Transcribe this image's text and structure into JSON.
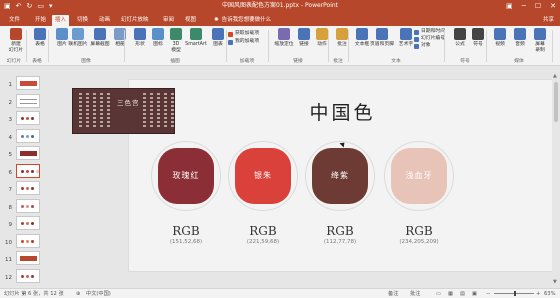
{
  "app": {
    "doc_title": "中国风图表配色方案01.pptx - PowerPoint"
  },
  "tabs": [
    "文件",
    "开始",
    "插入",
    "切换",
    "动画",
    "幻灯片放映",
    "审阅",
    "视图"
  ],
  "active_tab": "插入",
  "tell_me": "告诉我您想要做什么",
  "share_label": "共享",
  "ribbon": {
    "buttons": [
      {
        "label": "新建\n幻灯片",
        "icon": "new-slide-icon",
        "color": "#b7472a"
      },
      {
        "label": "表格",
        "icon": "table-icon",
        "color": "#4a73b8"
      },
      {
        "label": "图片",
        "icon": "picture-icon",
        "color": "#5a8fc9"
      },
      {
        "label": "联机图片",
        "icon": "online-picture-icon",
        "color": "#6b9bd1"
      },
      {
        "label": "屏幕截图",
        "icon": "screenshot-icon",
        "color": "#4a73b8"
      },
      {
        "label": "相册",
        "icon": "album-icon",
        "color": "#7a9bc7"
      },
      {
        "label": "形状",
        "icon": "shapes-icon",
        "color": "#4a73b8"
      },
      {
        "label": "图标",
        "icon": "icons-icon",
        "color": "#5a8fc9"
      },
      {
        "label": "3D\n模型",
        "icon": "3d-model-icon",
        "color": "#3d8a6b"
      },
      {
        "label": "SmartArt",
        "icon": "smartart-icon",
        "color": "#3d8a6b"
      },
      {
        "label": "图表",
        "icon": "chart-icon",
        "color": "#4a73b8"
      },
      {
        "label": "缩放定位",
        "icon": "zoom-icon",
        "color": "#7a6bb0"
      },
      {
        "label": "链接",
        "icon": "link-icon",
        "color": "#4a73b8"
      },
      {
        "label": "动作",
        "icon": "action-icon",
        "color": "#d6a13a"
      },
      {
        "label": "批注",
        "icon": "comment-icon",
        "color": "#d6a13a"
      },
      {
        "label": "文本框",
        "icon": "textbox-icon",
        "color": "#4a73b8"
      },
      {
        "label": "页眉和页脚",
        "icon": "header-footer-icon",
        "color": "#4a73b8"
      },
      {
        "label": "艺术字",
        "icon": "wordart-icon",
        "color": "#4a73b8"
      },
      {
        "label": "公式",
        "icon": "equation-icon",
        "color": "#444444"
      },
      {
        "label": "符号",
        "icon": "symbol-icon",
        "color": "#444444"
      },
      {
        "label": "视频",
        "icon": "video-icon",
        "color": "#4a73b8"
      },
      {
        "label": "音频",
        "icon": "audio-icon",
        "color": "#4a73b8"
      },
      {
        "label": "屏幕\n录制",
        "icon": "screen-record-icon",
        "color": "#4a73b8"
      }
    ],
    "addins": [
      {
        "label": "获取加载项",
        "color": "#d24726"
      },
      {
        "label": "我的加载项",
        "color": "#4a73b8"
      }
    ],
    "text_minis": [
      {
        "label": "日期和时间",
        "color": "#4a73b8"
      },
      {
        "label": "幻灯片编号",
        "color": "#4a73b8"
      },
      {
        "label": "对象",
        "color": "#4a73b8"
      }
    ],
    "groups": [
      "幻灯片",
      "表格",
      "图像",
      "插图",
      "加载项",
      "链接",
      "批注",
      "文本",
      "符号",
      "媒体"
    ]
  },
  "thumbnails": [
    {
      "num": "1",
      "style": "bar",
      "colors": [
        "#c94a3a"
      ]
    },
    {
      "num": "2",
      "style": "lines",
      "colors": [
        "#999999"
      ]
    },
    {
      "num": "3",
      "style": "dots",
      "colors": [
        "#8c3a3a",
        "#d8473b",
        "#6e3f3a"
      ]
    },
    {
      "num": "4",
      "style": "dots",
      "colors": [
        "#5a7fa8",
        "#7aa0c4",
        "#4a6a90"
      ]
    },
    {
      "num": "5",
      "style": "bar",
      "colors": [
        "#8c2e2e"
      ]
    },
    {
      "num": "6",
      "style": "dots",
      "colors": [
        "#8c2e35",
        "#d9413a",
        "#6e3b34",
        "#e8c3b8"
      ],
      "active": true
    },
    {
      "num": "7",
      "style": "dots",
      "colors": [
        "#a83a3a",
        "#d06a5a",
        "#7a3b3b"
      ]
    },
    {
      "num": "8",
      "style": "dots",
      "colors": [
        "#c06060",
        "#e09080",
        "#a05050"
      ]
    },
    {
      "num": "9",
      "style": "dots",
      "colors": [
        "#b04030",
        "#d27050",
        "#8a3020"
      ]
    },
    {
      "num": "10",
      "style": "dots",
      "colors": [
        "#d24726",
        "#e98060",
        "#b03a20"
      ]
    },
    {
      "num": "11",
      "style": "bar",
      "colors": [
        "#b7472a"
      ]
    },
    {
      "num": "12",
      "style": "dots",
      "colors": [
        "#a84040",
        "#c86060",
        "#884040"
      ]
    }
  ],
  "slide": {
    "title": "中国色",
    "swatches": [
      {
        "name": "玫瑰红",
        "color": "#8c2e35",
        "rgb_label": "RGB",
        "rgb_value": "(151,52,68)"
      },
      {
        "name": "银朱",
        "color": "#d9413a",
        "rgb_label": "RGB",
        "rgb_value": "(221,59,68)"
      },
      {
        "name": "绛紫",
        "color": "#6e3b34",
        "rgb_label": "RGB",
        "rgb_value": "(112,77,78)"
      },
      {
        "name": "浅血牙",
        "color": "#e8c3b8",
        "rgb_label": "RGB",
        "rgb_value": "(234,205,209)"
      }
    ]
  },
  "overlay_picture": {
    "heading": "三色宫"
  },
  "status": {
    "slide_info": "幻灯片 第 6 张，共 12 张",
    "language": "中文(中国)",
    "notes": "备注",
    "comments": "批注",
    "zoom": "63%"
  }
}
